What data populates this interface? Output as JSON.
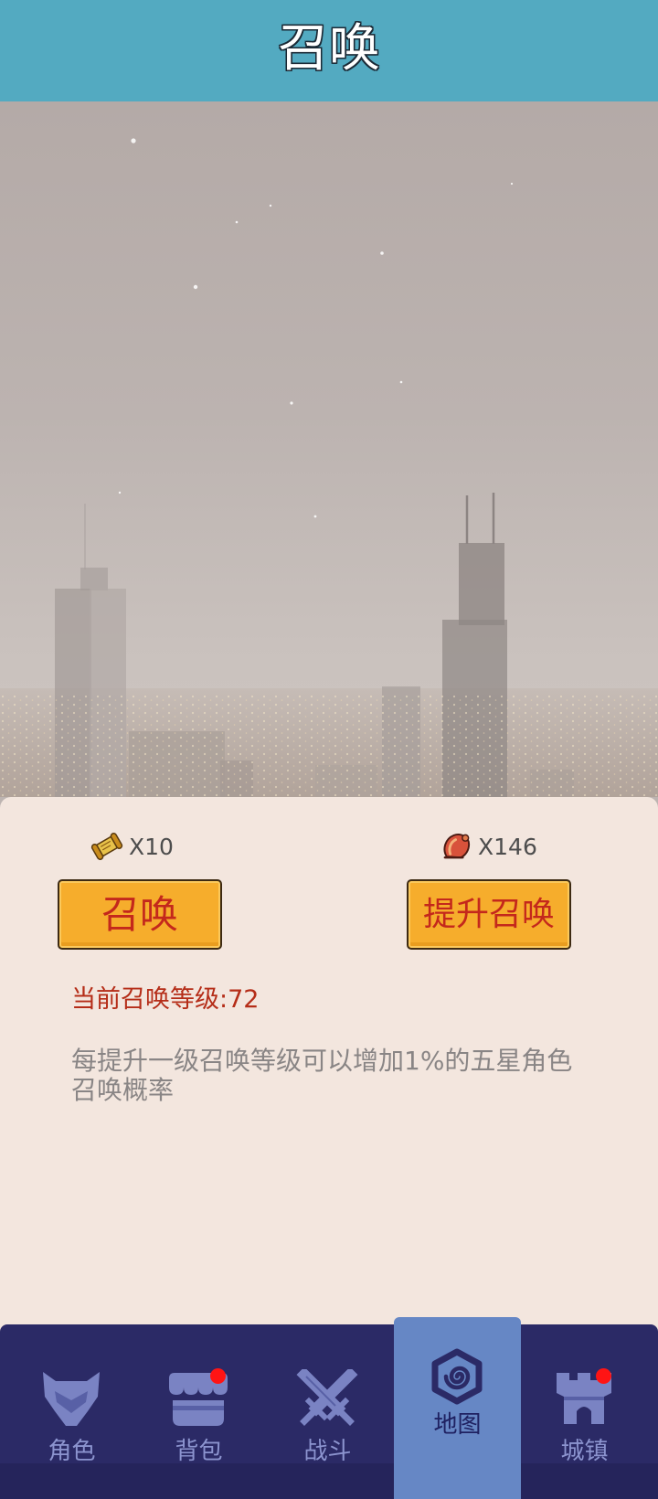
{
  "header": {
    "title": "召唤"
  },
  "resources": [
    {
      "icon": "scroll-icon",
      "count": "X10"
    },
    {
      "icon": "meat-icon",
      "count": "X146"
    }
  ],
  "actions": {
    "summon_label": "召唤",
    "upgrade_label": "提升召唤"
  },
  "summon_level": {
    "label": "当前召唤等级:",
    "value": "72"
  },
  "description": "每提升一级召唤等级可以增加1%的五星角色召唤概率",
  "nav": {
    "items": [
      {
        "label": "角色",
        "icon": "helmet-icon",
        "active": false,
        "badge": false
      },
      {
        "label": "背包",
        "icon": "shop-icon",
        "active": false,
        "badge": true
      },
      {
        "label": "战斗",
        "icon": "crossed-swords-icon",
        "active": false,
        "badge": false
      },
      {
        "label": "地图",
        "icon": "hexagon-spiral-icon",
        "active": true,
        "badge": false
      },
      {
        "label": "城镇",
        "icon": "castle-icon",
        "active": false,
        "badge": true
      }
    ]
  },
  "colors": {
    "header_bg": "#53aac1",
    "panel_bg": "#f3e6de",
    "button_bg": "#f6ad2c",
    "button_text": "#c4281c",
    "level_text": "#b52d18",
    "nav_bg": "#2b2a66",
    "nav_active_bg": "#6687c5",
    "nav_icon": "#7a83c3",
    "badge": "#ff1414"
  }
}
